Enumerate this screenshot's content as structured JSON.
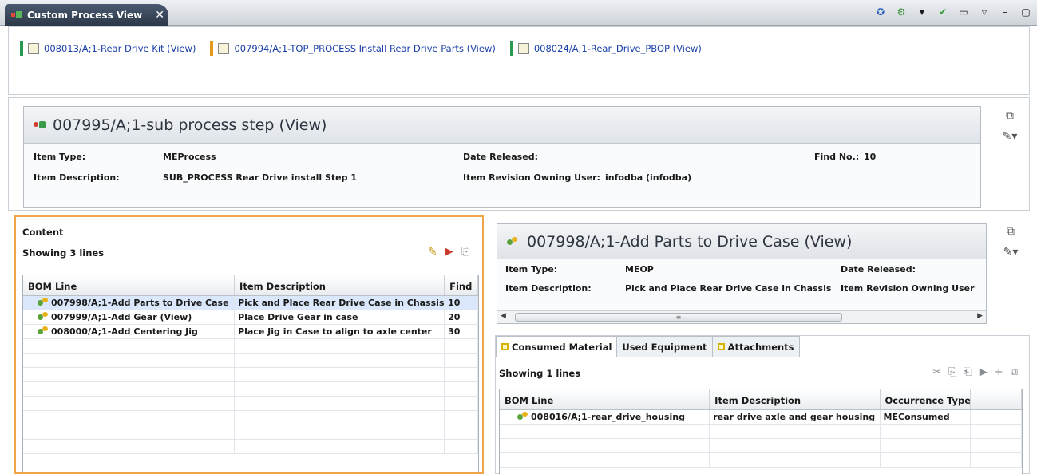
{
  "view": {
    "title": "Custom Process View"
  },
  "breadcrumbs": [
    {
      "label": "008013/A;1-Rear Drive Kit (View)",
      "bar_color": "#2a9a50"
    },
    {
      "label": "007994/A;1-TOP_PROCESS Install Rear Drive Parts (View)",
      "bar_color": "#e39b1b"
    },
    {
      "label": "008024/A;1-Rear_Drive_PBOP (View)",
      "bar_color": "#2a9a50"
    }
  ],
  "process_step": {
    "title": "007995/A;1-sub process step (View)",
    "item_type_label": "Item Type:",
    "item_type": "MEProcess",
    "item_desc_label": "Item Description:",
    "item_desc": "SUB_PROCESS Rear Drive install Step 1",
    "date_released_label": "Date Released:",
    "owner_label": "Item Revision Owning User:",
    "owner": "infodba (infodba)",
    "find_no_label": "Find No.:",
    "find_no": "10"
  },
  "content": {
    "header": "Content",
    "showing": "Showing 3 lines",
    "columns": [
      "BOM Line",
      "Item Description",
      "Find"
    ],
    "rows": [
      [
        "007998/A;1-Add Parts to Drive Case",
        "Pick and Place Rear Drive Case in Chassis",
        "10"
      ],
      [
        "007999/A;1-Add Gear (View)",
        "Place Drive Gear in case",
        "20"
      ],
      [
        "008000/A;1-Add Centering Jig",
        "Place Jig in Case to align to axle center",
        "30"
      ]
    ]
  },
  "operation": {
    "title": "007998/A;1-Add Parts to Drive Case (View)",
    "item_type_label": "Item Type:",
    "item_type": "MEOP",
    "item_desc_label": "Item Description:",
    "item_desc": "Pick and Place Rear Drive Case in Chassis",
    "date_released_label": "Date Released:",
    "owner_label": "Item Revision Owning User"
  },
  "tabs": [
    {
      "label": "Consumed Material",
      "active": true
    },
    {
      "label": "Used Equipment",
      "active": false
    },
    {
      "label": "Attachments",
      "active": false
    }
  ],
  "consumed": {
    "showing": "Showing 1 lines",
    "columns": [
      "BOM Line",
      "Item Description",
      "Occurrence Type"
    ],
    "rows": [
      [
        "008016/A;1-rear_drive_housing",
        "rear drive axle and gear housing",
        "MEConsumed"
      ]
    ]
  },
  "colors": {
    "accent_orange": "#f0a54a",
    "link_blue": "#1a3fa8",
    "selection": "#dbe8fb"
  }
}
